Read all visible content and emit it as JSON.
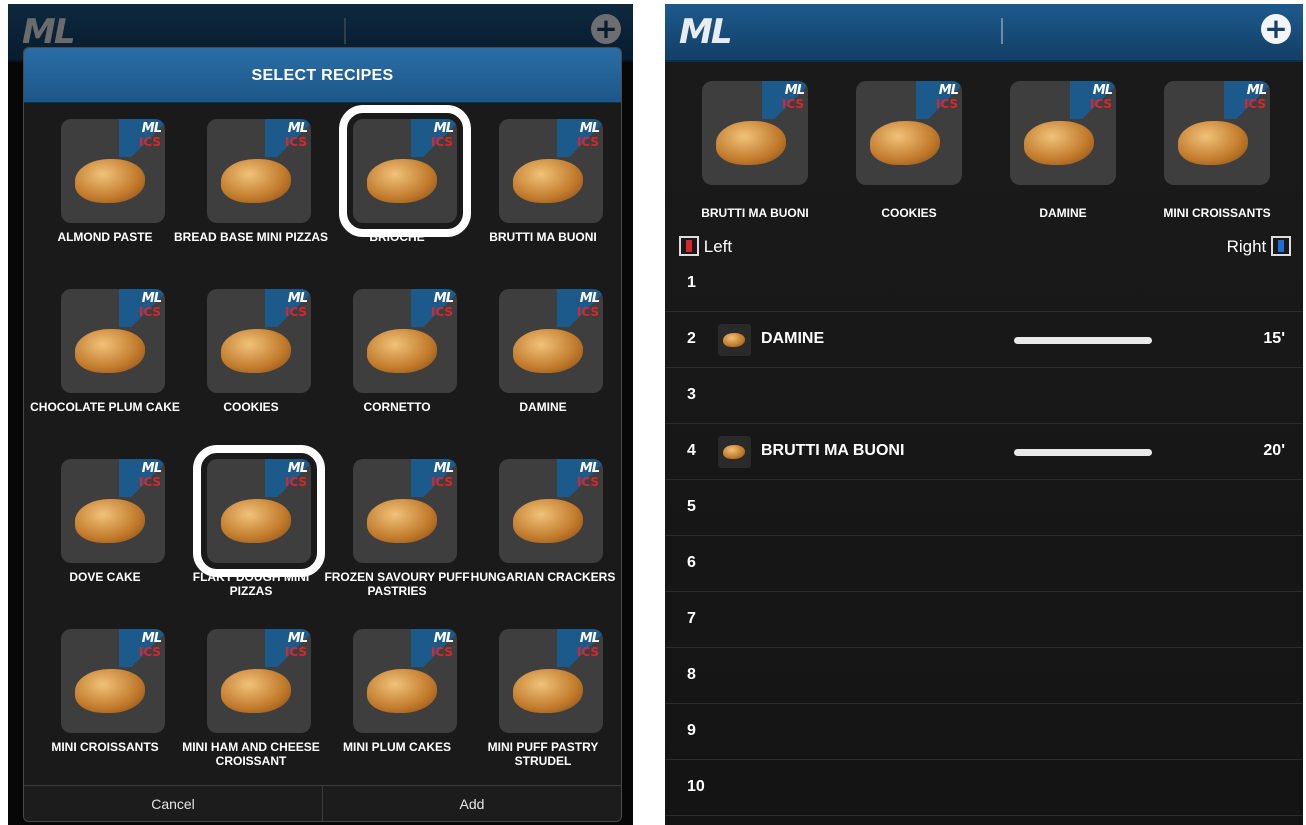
{
  "left": {
    "logo": "ML",
    "dialog": {
      "title": "SELECT RECIPES",
      "recipes": [
        {
          "label": "ALMOND PASTE",
          "selected": false
        },
        {
          "label": "BREAD BASE MINI PIZZAS",
          "selected": false
        },
        {
          "label": "BRIOCHE",
          "selected": true
        },
        {
          "label": "BRUTTI MA BUONI",
          "selected": false
        },
        {
          "label": "CHOCOLATE PLUM CAKE",
          "selected": false
        },
        {
          "label": "COOKIES",
          "selected": false
        },
        {
          "label": "CORNETTO",
          "selected": false
        },
        {
          "label": "DAMINE",
          "selected": false
        },
        {
          "label": "DOVE CAKE",
          "selected": false
        },
        {
          "label": "FLAKY DOUGH MINI PIZZAS",
          "selected": true
        },
        {
          "label": "FROZEN SAVOURY PUFF PASTRIES",
          "selected": false
        },
        {
          "label": "HUNGARIAN CRACKERS",
          "selected": false
        },
        {
          "label": "MINI CROISSANTS",
          "selected": false
        },
        {
          "label": "MINI HAM AND CHEESE CROISSANT",
          "selected": false
        },
        {
          "label": "MINI PLUM CAKES",
          "selected": false
        },
        {
          "label": "MINI PUFF PASTRY STRUDEL",
          "selected": false
        }
      ],
      "badge_ml": "ML",
      "badge_ics": "ICS",
      "cancel_label": "Cancel",
      "add_label": "Add"
    }
  },
  "right": {
    "logo": "ML",
    "top_recipes": [
      "BRUTTI MA BUONI",
      "COOKIES",
      "DAMINE",
      "MINI CROISSANTS"
    ],
    "left_label": "Left",
    "right_label": "Right",
    "rows": [
      {
        "num": "1",
        "name": "",
        "time": ""
      },
      {
        "num": "2",
        "name": "DAMINE",
        "time": "15'"
      },
      {
        "num": "3",
        "name": "",
        "time": ""
      },
      {
        "num": "4",
        "name": "BRUTTI MA BUONI",
        "time": "20'"
      },
      {
        "num": "5",
        "name": "",
        "time": ""
      },
      {
        "num": "6",
        "name": "",
        "time": ""
      },
      {
        "num": "7",
        "name": "",
        "time": ""
      },
      {
        "num": "8",
        "name": "",
        "time": ""
      },
      {
        "num": "9",
        "name": "",
        "time": ""
      },
      {
        "num": "10",
        "name": "",
        "time": ""
      }
    ]
  },
  "colors": {
    "accent": "#1d5a8c",
    "badge_red": "#d9262c",
    "left_check": "#d9262c",
    "right_check": "#1f6fd6"
  },
  "icons": {
    "add": "plus-circle-icon"
  }
}
